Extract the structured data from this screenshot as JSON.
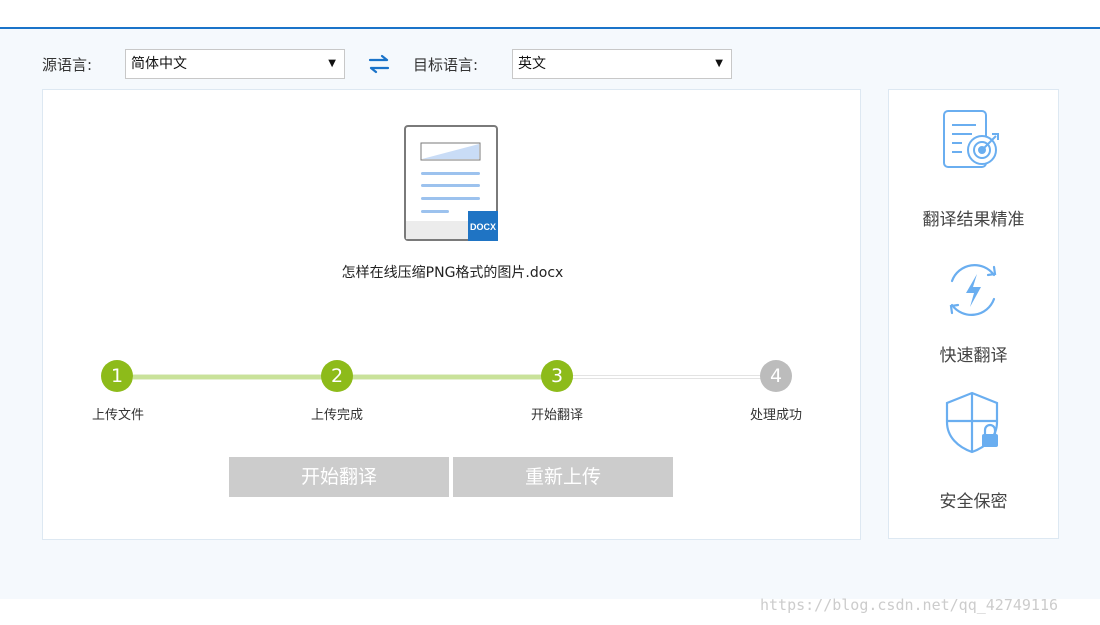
{
  "languages": {
    "source_label": "源语言:",
    "source_value": "简体中文",
    "target_label": "目标语言:",
    "target_value": "英文"
  },
  "file": {
    "name": "怎样在线压缩PNG格式的图片.docx",
    "badge": "DOCX"
  },
  "steps": [
    {
      "number": "1",
      "label": "上传文件",
      "state": "done"
    },
    {
      "number": "2",
      "label": "上传完成",
      "state": "done"
    },
    {
      "number": "3",
      "label": "开始翻译",
      "state": "done"
    },
    {
      "number": "4",
      "label": "处理成功",
      "state": "pending"
    }
  ],
  "buttons": {
    "start_translate": "开始翻译",
    "reupload": "重新上传"
  },
  "features": [
    {
      "label": "翻译结果精准",
      "icon": "accuracy-target-icon"
    },
    {
      "label": "快速翻译",
      "icon": "lightning-refresh-icon"
    },
    {
      "label": "安全保密",
      "icon": "shield-lock-icon"
    }
  ],
  "colors": {
    "accent_blue": "#1a73c9",
    "step_done": "#8dbb1a",
    "step_pending": "#bcbcbc",
    "icon_blue": "#6aaef0",
    "button_disabled": "#cccccc"
  },
  "watermark": "https://blog.csdn.net/qq_42749116"
}
